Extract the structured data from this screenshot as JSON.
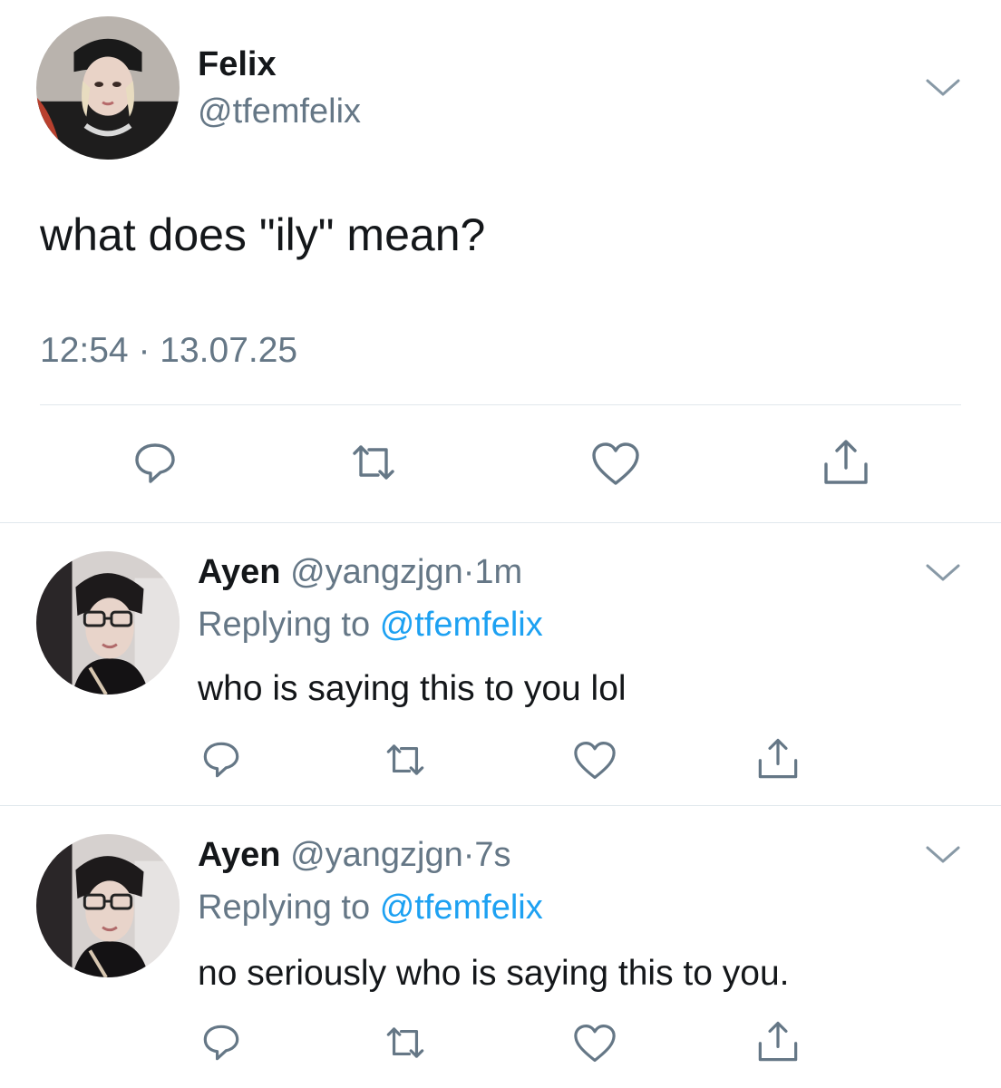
{
  "colors": {
    "text": "#14171a",
    "secondary": "#657786",
    "link": "#1da1f2",
    "divider": "#e1e8ed",
    "icon": "#657786"
  },
  "main_tweet": {
    "display_name": "Felix",
    "handle": "@tfemfelix",
    "text": "what does \"ily\" mean?",
    "time": "12:54",
    "separator": "·",
    "date": "13.07.25",
    "avatar_icon": "profile-photo",
    "actions": [
      "reply-icon",
      "retweet-icon",
      "like-icon",
      "share-icon"
    ]
  },
  "replies": [
    {
      "display_name": "Ayen",
      "handle": "@yangzjgn",
      "dot": "·",
      "time": "1m",
      "replying_label": "Replying to",
      "replying_to": "@tfemfelix",
      "text": "who is saying this to you lol"
    },
    {
      "display_name": "Ayen",
      "handle": "@yangzjgn",
      "dot": "·",
      "time": "7s",
      "replying_label": "Replying to",
      "replying_to": "@tfemfelix",
      "text": "no seriously who is saying this to you."
    }
  ]
}
